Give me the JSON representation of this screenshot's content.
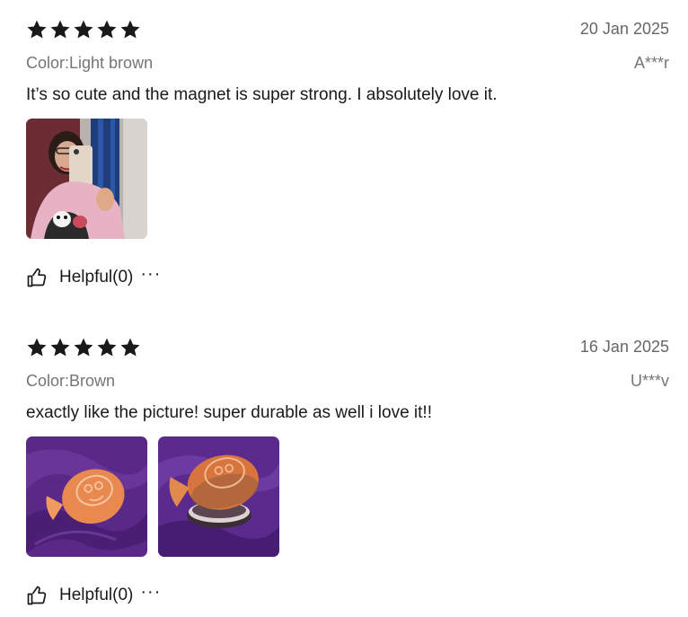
{
  "reviews": [
    {
      "rating": 5,
      "date": "20 Jan 2025",
      "color": "Color:Light brown",
      "author": "A***r",
      "text": "It’s so cute and the magnet is super strong. I absolutely love it.",
      "helpful_label": "Helpful(0)",
      "more_label": "···",
      "photos": [
        "selfie-photo"
      ]
    },
    {
      "rating": 5,
      "date": "16 Jan 2025",
      "color": "Color:Brown",
      "author": "U***v",
      "text": "exactly like the picture! super durable as well i love it!!",
      "helpful_label": "Helpful(0)",
      "more_label": "···",
      "photos": [
        "fish-magnet-photo-front",
        "fish-magnet-photo-angle"
      ]
    }
  ],
  "colors": {
    "star": "#191919",
    "muted_text": "#757575",
    "date_text": "#666666",
    "purple_fabric": "#5e2a8a",
    "magnet_orange": "#e98d5a"
  }
}
